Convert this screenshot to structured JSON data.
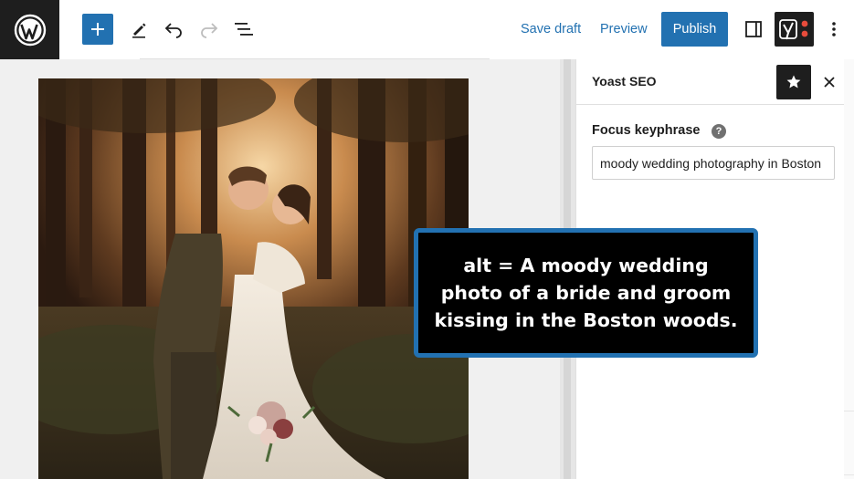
{
  "toolbar": {
    "logo_icon": "wordpress-logo-icon",
    "add_block_icon": "plus-icon",
    "tools_icon": "pencil-icon",
    "undo_icon": "undo-icon",
    "redo_icon": "redo-icon",
    "list_view_icon": "list-view-icon",
    "save_draft_label": "Save draft",
    "preview_label": "Preview",
    "publish_label": "Publish",
    "settings_icon": "sidebar-toggle-icon",
    "yoast_icon": "yoast-logo-icon",
    "more_icon": "vertical-ellipsis-icon",
    "accent_color": "#2271b1"
  },
  "editor": {
    "image_subject": "wedding-photo-image"
  },
  "sidebar": {
    "title": "Yoast SEO",
    "pin_icon": "star-icon",
    "close_icon": "close-icon",
    "focus_keyphrase_label": "Focus keyphrase",
    "help_icon": "question-mark-icon",
    "help_glyph": "?",
    "focus_keyphrase_value": "moody wedding photography in Boston"
  },
  "callout": {
    "text": "alt = A moody wedding photo of a bride and groom kissing in the Boston woods.",
    "border_color": "#2271b1"
  }
}
